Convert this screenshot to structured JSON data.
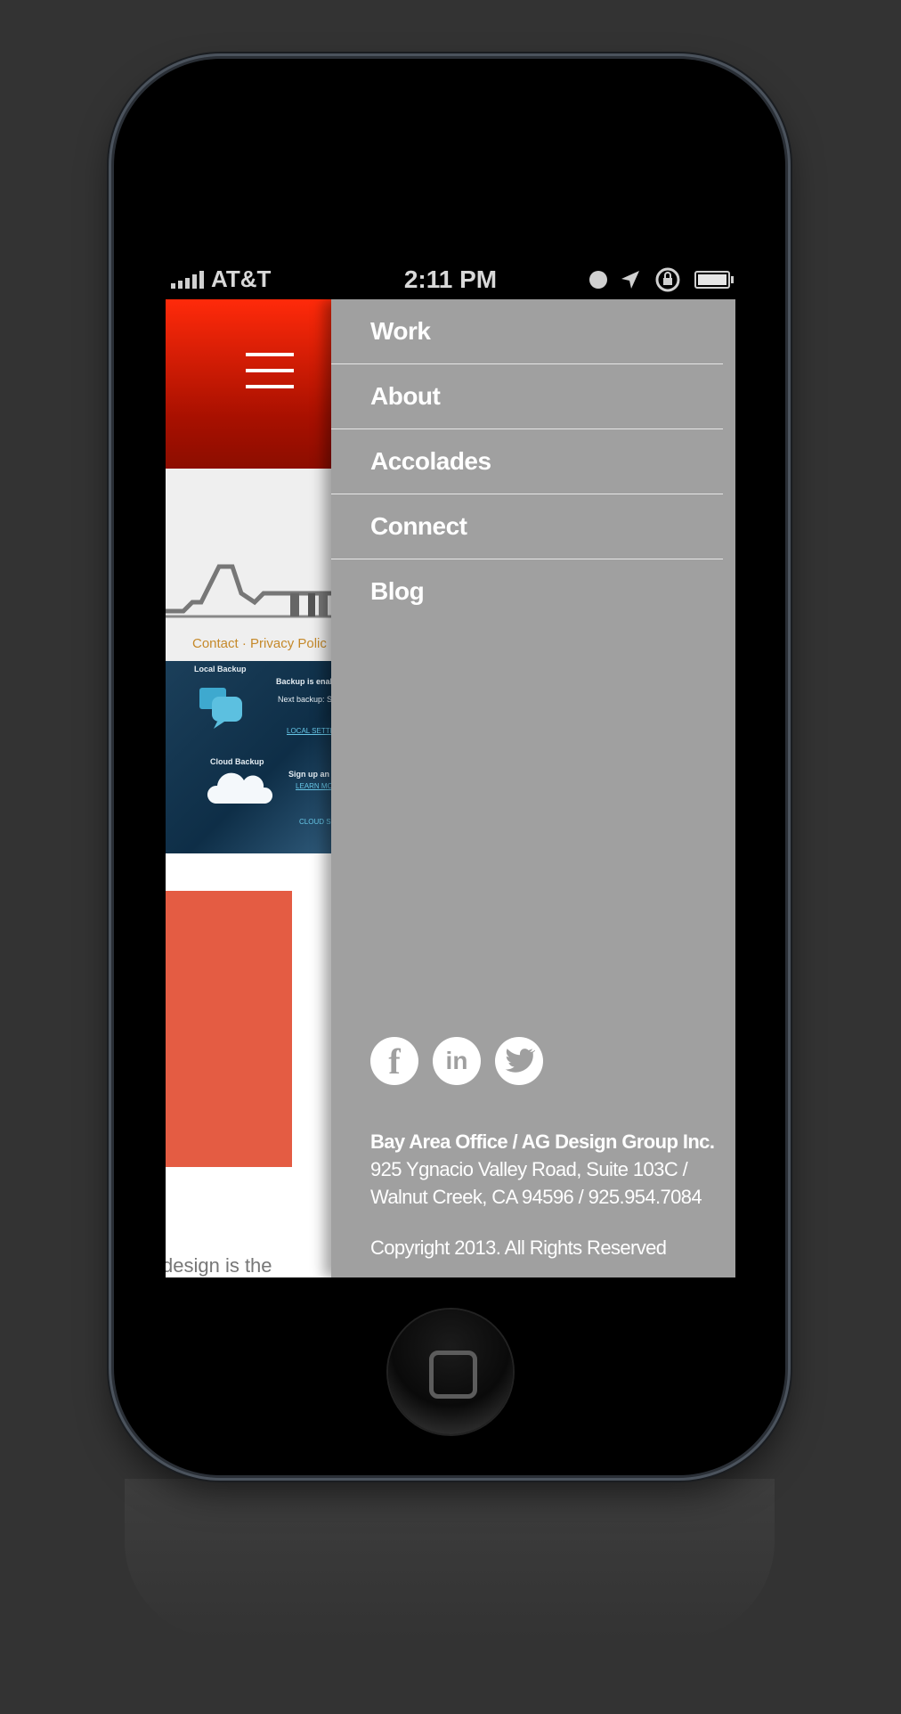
{
  "status_bar": {
    "carrier": "AT&T",
    "time": "2:11 PM"
  },
  "menu": {
    "items": [
      {
        "label": "Work"
      },
      {
        "label": "About"
      },
      {
        "label": "Accolades"
      },
      {
        "label": "Connect"
      },
      {
        "label": "Blog"
      }
    ]
  },
  "social": [
    {
      "name": "facebook-icon",
      "glyph": "f"
    },
    {
      "name": "linkedin-icon",
      "glyph": "in"
    },
    {
      "name": "twitter-icon",
      "glyph": "🐦"
    }
  ],
  "footer": {
    "office": "Bay Area Office / AG Design Group Inc.",
    "address_line1": "925 Ygnacio Valley Road, Suite 103C /",
    "address_line2": "Walnut Creek, CA 94596 / 925.954.7084",
    "copyright": "Copyright 2013. All Rights Reserved"
  },
  "peek": {
    "links": "Contact · Privacy Polic",
    "dashboard": {
      "local_backup": "Local Backup",
      "backup_enabled": "Backup is enab",
      "next_backup": "Next backup: Sep",
      "local_settings": "LOCAL SETTI",
      "cloud_backup": "Cloud Backup",
      "sign_up": "Sign up an",
      "learn_more": "LEARN MO",
      "cloud_settings": "CLOUD S"
    },
    "body_text": "design is the"
  },
  "colors": {
    "header_red": "#ff2a0a",
    "drawer_gray": "#a0a0a0",
    "coral": "#e45c43"
  }
}
